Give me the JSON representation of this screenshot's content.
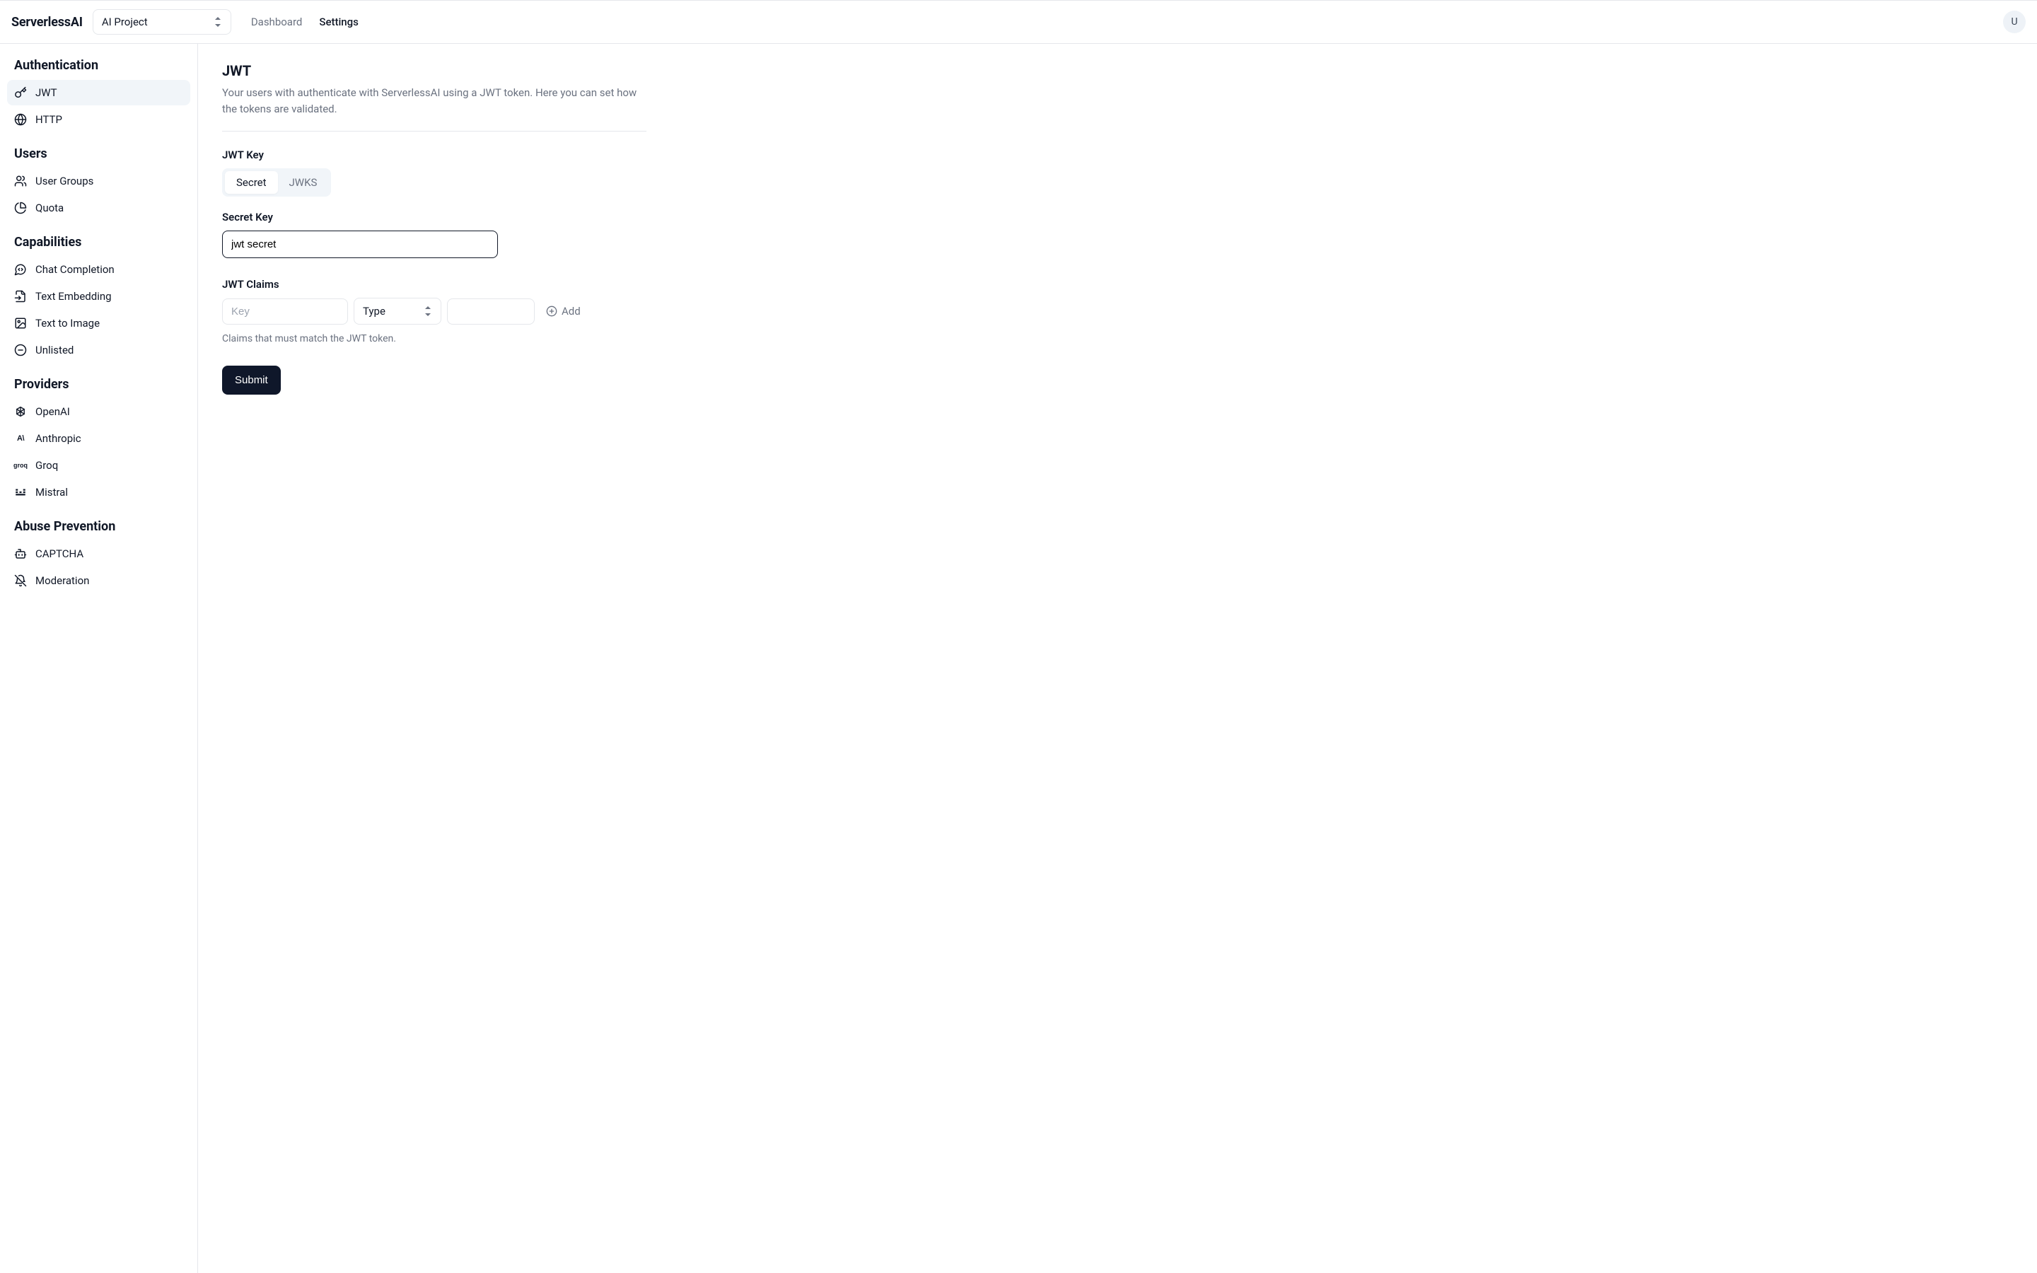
{
  "header": {
    "brand": "ServerlessAI",
    "project_name": "AI Project",
    "nav": {
      "dashboard": "Dashboard",
      "settings": "Settings"
    },
    "avatar_letter": "U"
  },
  "sidebar": {
    "authentication": {
      "title": "Authentication",
      "items": [
        "JWT",
        "HTTP"
      ]
    },
    "users": {
      "title": "Users",
      "items": [
        "User Groups",
        "Quota"
      ]
    },
    "capabilities": {
      "title": "Capabilities",
      "items": [
        "Chat Completion",
        "Text Embedding",
        "Text to Image",
        "Unlisted"
      ]
    },
    "providers": {
      "title": "Providers",
      "items": [
        "OpenAI",
        "Anthropic",
        "Groq",
        "Mistral"
      ]
    },
    "abuse": {
      "title": "Abuse Prevention",
      "items": [
        "CAPTCHA",
        "Moderation"
      ]
    }
  },
  "main": {
    "title": "JWT",
    "description": "Your users with authenticate with ServerlessAI using a JWT token. Here you can set how the tokens are validated.",
    "jwt_key_label": "JWT Key",
    "tabs": {
      "secret": "Secret",
      "jwks": "JWKS"
    },
    "secret_key_label": "Secret Key",
    "secret_key_value": "jwt secret",
    "claims_label": "JWT Claims",
    "claims_key_placeholder": "Key",
    "claims_type_placeholder": "Type",
    "claims_value_placeholder": "",
    "add_label": "Add",
    "claims_helper": "Claims that must match the JWT token.",
    "submit_label": "Submit"
  }
}
